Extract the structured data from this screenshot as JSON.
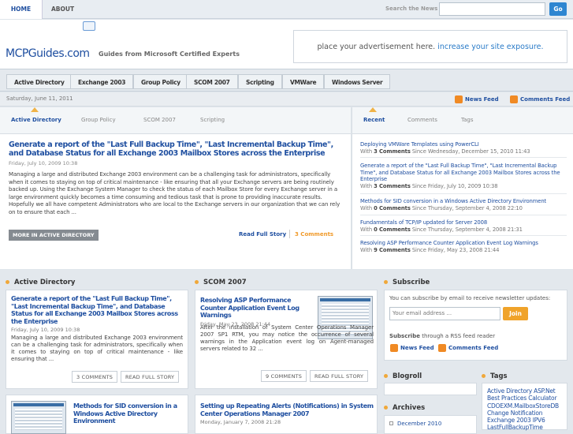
{
  "topnav": {
    "home": "HOME",
    "about": "ABOUT"
  },
  "search": {
    "label": "Search the News",
    "go": "Go"
  },
  "header": {
    "logo": "MCPGuides.com",
    "tagline": "Guides from Microsoft Certified Experts",
    "ad_text": "place your advertisement here.",
    "ad_highlight": "increase your site exposure."
  },
  "nav": [
    "Active Directory",
    "Exchange 2003",
    "Group Policy",
    "SCOM 2007",
    "Scripting",
    "VMWare",
    "Windows Server"
  ],
  "datebar": {
    "date": "Saturday, June 11, 2011",
    "news_feed": "News Feed",
    "comments_feed": "Comments Feed"
  },
  "main_tabs": [
    "Active Directory",
    "Group Policy",
    "SCOM 2007",
    "Scripting"
  ],
  "featured": {
    "title": "Generate a report of the \"Last Full Backup Time\", \"Last Incremental Backup Time\", and Database Status for all Exchange 2003 Mailbox Stores across the Enterprise",
    "date": "Friday, July 10, 2009 10:38",
    "body": "Managing a large and distributed Exchange 2003 environment can be a challenging task for administrators, specifically when it comes to staying on top of critical maintenance - like ensuring that all your Exchange servers are being routinely backed up. Using the Exchange System Manager to check the status of each Mailbox Store for every Exchange server in a large environment quickly becomes a time consuming and tedious task that is prone to providing inaccurate results. Hopefully we all have competent Administrators who are local to the Exchange servers in our organization that we can rely on to ensure that each ...",
    "more": "MORE IN ACTIVE DIRECTORY",
    "read_full": "Read Full Story",
    "comments": "3 Comments"
  },
  "side_tabs": [
    "Recent",
    "Comments",
    "Tags"
  ],
  "recent": [
    {
      "title": "Deploying VMWare Templates using PowerCLI",
      "count": "3 Comments",
      "since": "Since Wednesday, December 15, 2010 11:43"
    },
    {
      "title": "Generate a report of the \"Last Full Backup Time\", \"Last Incremental Backup Time\", and Database Status for all Exchange 2003 Mailbox Stores across the Enterprise",
      "count": "3 Comments",
      "since": "Since Friday, July 10, 2009 10:38"
    },
    {
      "title": "Methods for SID conversion in a Windows Active Directory Environment",
      "count": "0 Comments",
      "since": "Since Thursday, September 4, 2008 22:10"
    },
    {
      "title": "Fundamentals of TCP/IP updated for Server 2008",
      "count": "0 Comments",
      "since": "Since Thursday, September 4, 2008 21:31"
    },
    {
      "title": "Resolving ASP Performance Counter Application Event Log Warnings",
      "count": "9 Comments",
      "since": "Since Friday, May 23, 2008 21:44"
    }
  ],
  "with": "With",
  "ad_col": {
    "heading": "Active Directory",
    "post1": {
      "title": "Generate a report of the \"Last Full Backup Time\", \"Last Incremental Backup Time\", and Database Status for all Exchange 2003 Mailbox Stores across the Enterprise",
      "date": "Friday, July 10, 2009 10:38",
      "body": "Managing a large and distributed Exchange 2003 environment can be a challenging task for administrators, specifically when it comes to staying on top of critical maintenance - like ensuring that ...",
      "comments": "3 COMMENTS",
      "read": "READ FULL STORY"
    },
    "post2": {
      "title": "Methods for SID conversion in a Windows Active Directory Environment"
    }
  },
  "scom_col": {
    "heading": "SCOM 2007",
    "post1": {
      "title": "Resolving ASP Performance Counter Application Event Log Warnings",
      "date": "Friday, May 23, 2008 21:44",
      "body": "After the installation of System Center Operations Manager 2007 SP1 RTM, you may notice the occurrence of several warnings in the Application event log on Agent-managed servers related to 32 ...",
      "comments": "9 COMMENTS",
      "read": "READ FULL STORY"
    },
    "post2": {
      "title": "Setting up Repeating Alerts (Notifications) in System Center Operations Manager 2007",
      "date": "Monday, January 7, 2008 21:28"
    }
  },
  "subscribe": {
    "heading": "Subscribe",
    "text": "You can subscribe by email to receive newsletter updates:",
    "placeholder": "Your email address ...",
    "join": "Join",
    "rss_bold": "Subscribe",
    "rss_rest": " through a RSS feed reader",
    "news_feed": "News Feed",
    "comments_feed": "Comments Feed"
  },
  "blogroll": {
    "heading": "Blogroll"
  },
  "archives": {
    "heading": "Archives",
    "items": [
      "December 2010"
    ]
  },
  "tags": {
    "heading": "Tags",
    "text": "Active Directory ASP.Net Best Practices Calculator CDOEXM.MailboxStoreDB Change Notification Exchange 2003 IPV6 LastFullBackupTime"
  }
}
